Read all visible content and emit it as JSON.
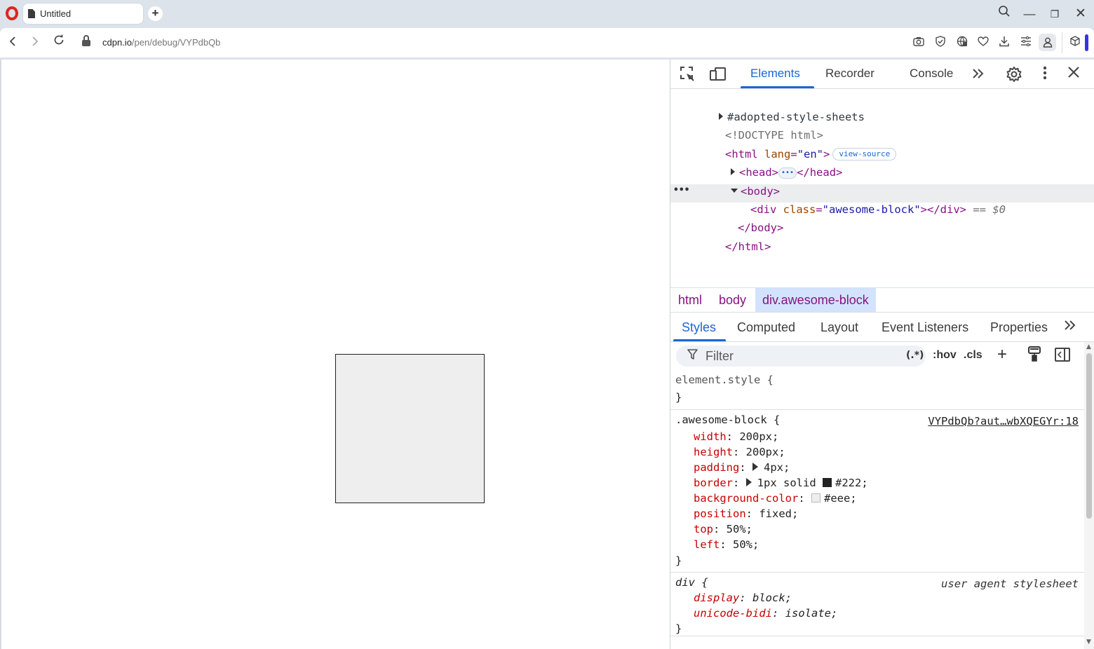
{
  "browser": {
    "tab": {
      "title": "Untitled"
    },
    "new_tab_symbol": "+",
    "window": {
      "minimize": "—",
      "restore": "❐",
      "close": "✕",
      "search": "⚲"
    },
    "address": {
      "host": "cdpn.io",
      "path": "/pen/debug/VYPdbQb"
    },
    "icons": [
      "camera-icon",
      "shield-icon",
      "vpn-icon",
      "heart-icon",
      "download-icon",
      "easy-setup-icon",
      "profile-icon",
      "extensions-icon"
    ],
    "accent_color": "#3a32e6",
    "logo_color": "#e0241f"
  },
  "page": {
    "block": {
      "background": "#eee",
      "border": "#222"
    }
  },
  "devtools": {
    "tabs": {
      "elements": "Elements",
      "recorder": "Recorder",
      "console": "Console"
    },
    "dom": {
      "adopted": "#adopted-style-sheets",
      "doctype": "<!DOCTYPE html>",
      "html_open_tag": "<html",
      "html_attr_name": " lang",
      "html_attr_eq": "=",
      "html_attr_value": "\"en\"",
      "html_close_bracket": ">",
      "view_source": "view-source",
      "head_open": "<head>",
      "head_close": "</head>",
      "head_ellipsis": "•••",
      "body_open": "<body>",
      "div_open": "<div",
      "div_attr_name": " class",
      "div_attr_eq": "=",
      "div_attr_value": "\"awesome-block\"",
      "div_close": "></div>",
      "selected_marker": " == ",
      "dollar": "$0",
      "row_dots": "•••",
      "body_close": "</body>",
      "html_close": "</html>"
    },
    "breadcrumb": [
      "html",
      "body",
      "div.awesome-block"
    ],
    "sub_tabs": {
      "styles": "Styles",
      "computed": "Computed",
      "layout": "Layout",
      "listeners": "Event Listeners",
      "properties": "Properties"
    },
    "filter": {
      "placeholder": "Filter",
      "regex": "(.*)",
      "hov": ":hov",
      "cls": ".cls",
      "add": "+"
    },
    "styles": {
      "element_style": {
        "selector": "element.style {",
        "close": "}"
      },
      "awesome_rule": {
        "selector": ".awesome-block {",
        "source": "VYPdbQb?aut…wbXQEGYr:18",
        "close": "}",
        "props": [
          {
            "name": "width",
            "value": "200px;"
          },
          {
            "name": "height",
            "value": "200px;"
          },
          {
            "name": "padding",
            "value": "4px;"
          },
          {
            "name": "border",
            "value": "1px solid "
          },
          {
            "name": "border_color",
            "value": "#222;"
          },
          {
            "name": "background-color",
            "value": "#eee;"
          },
          {
            "name": "position",
            "value": "fixed;"
          },
          {
            "name": "top",
            "value": "50%;"
          },
          {
            "name": "left",
            "value": "50%;"
          }
        ]
      },
      "ua_rule": {
        "selector": "div {",
        "source": "user agent stylesheet",
        "close": "}",
        "props": [
          {
            "name": "display",
            "value": "block;"
          },
          {
            "name": "unicode-bidi",
            "value": "isolate;"
          }
        ]
      },
      "colon": ": "
    }
  }
}
